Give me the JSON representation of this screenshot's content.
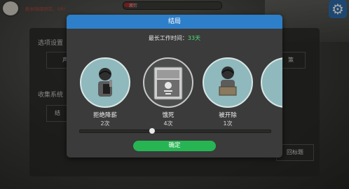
{
  "hud": {
    "status_text": "剧本随缘研究，GR!",
    "progress_label": "疲劳",
    "progress_fraction": 0.12
  },
  "settings_bg": {
    "label_options": "选项设置",
    "label_sound": "声音",
    "label_collection": "收集系统",
    "button_right": "策",
    "button_left_collection": "结",
    "button_title": "回标题"
  },
  "dialog": {
    "title": "结局",
    "max_work_label": "最长工作时间：",
    "max_work_value": "33天",
    "cards": [
      {
        "name": "拒绝降薪",
        "count": "2次",
        "icon": "man-holding-phone"
      },
      {
        "name": "饿死",
        "count": "4次",
        "icon": "skeleton-in-fridge"
      },
      {
        "name": "被开除",
        "count": "1次",
        "icon": "man-holding-box"
      }
    ],
    "scroll_position": 0.38,
    "ok_label": "确定"
  },
  "colors": {
    "header": "#2e7fc9",
    "ok_button": "#26b552",
    "highlight_value": "#4fe07e",
    "gear": "#2f6fb0"
  }
}
